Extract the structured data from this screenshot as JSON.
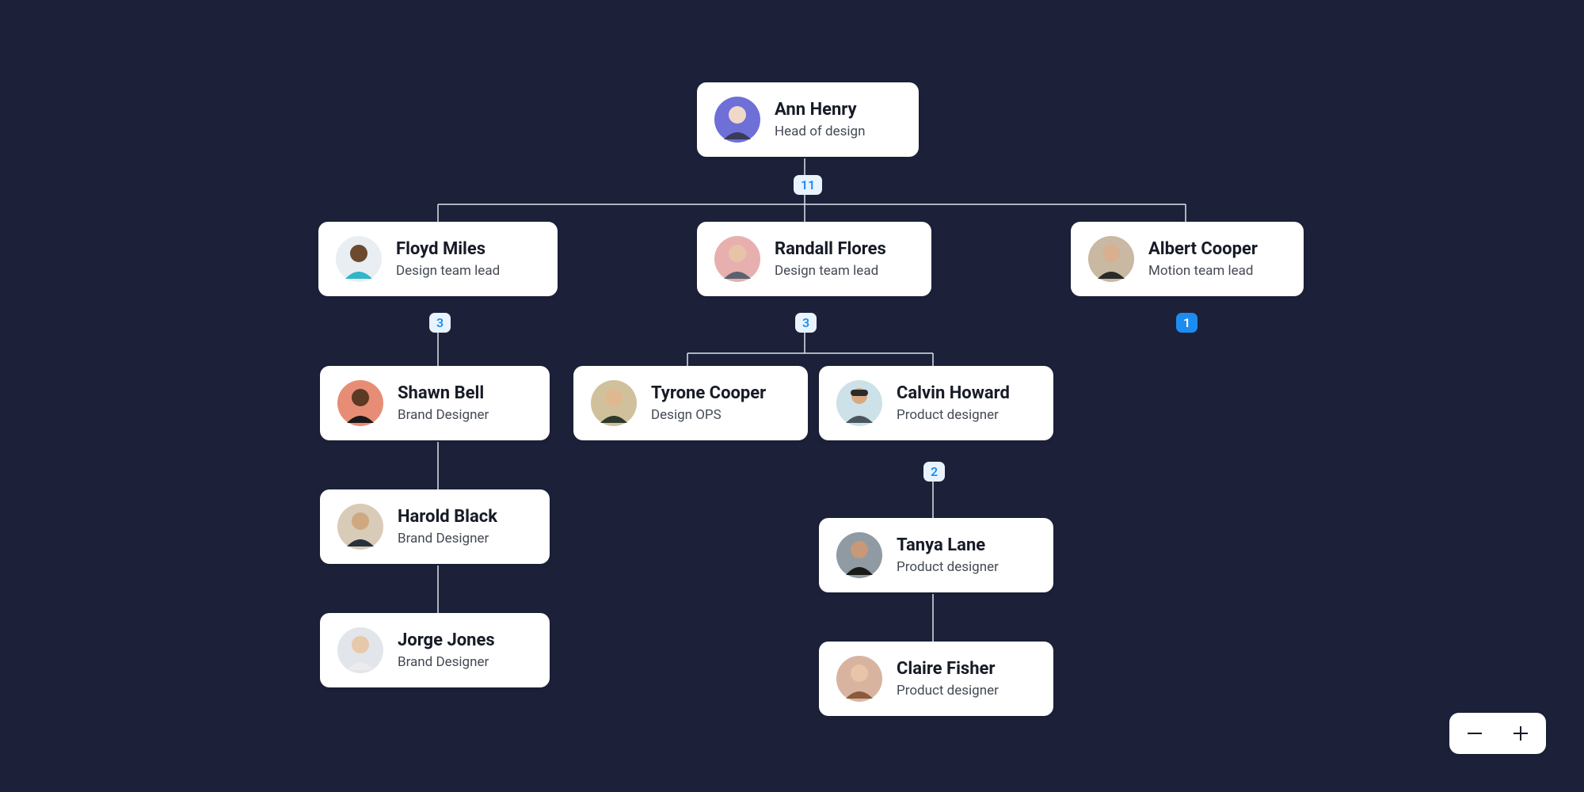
{
  "nodes": {
    "root": {
      "name": "Ann Henry",
      "role": "Head of design",
      "badge": "11",
      "avatarColor": "#6f6fd8"
    },
    "floyd": {
      "name": "Floyd Miles",
      "role": "Design team lead",
      "badge": "3",
      "avatarColor": "#e9eef3"
    },
    "randall": {
      "name": "Randall Flores",
      "role": "Design team lead",
      "badge": "3",
      "avatarColor": "#e8afaf"
    },
    "albert": {
      "name": "Albert Cooper",
      "role": "Motion team lead",
      "badge": "1",
      "avatarColor": "#c9b8a2"
    },
    "shawn": {
      "name": "Shawn Bell",
      "role": "Brand Designer",
      "avatarColor": "#e78d75"
    },
    "harold": {
      "name": "Harold Black",
      "role": "Brand Designer",
      "avatarColor": "#d8cbb8"
    },
    "jorge": {
      "name": "Jorge Jones",
      "role": "Brand Designer",
      "avatarColor": "#e2e6ea"
    },
    "tyrone": {
      "name": "Tyrone Cooper",
      "role": "Design OPS",
      "avatarColor": "#d0c19c"
    },
    "calvin": {
      "name": "Calvin Howard",
      "role": "Product designer",
      "badge": "2",
      "avatarColor": "#cde1e8"
    },
    "tanya": {
      "name": "Tanya Lane",
      "role": "Product designer",
      "avatarColor": "#8f9aa3"
    },
    "claire": {
      "name": "Claire Fisher",
      "role": "Product designer",
      "avatarColor": "#d8b4a0"
    }
  },
  "zoom": {
    "minus": "−",
    "plus": "+"
  }
}
